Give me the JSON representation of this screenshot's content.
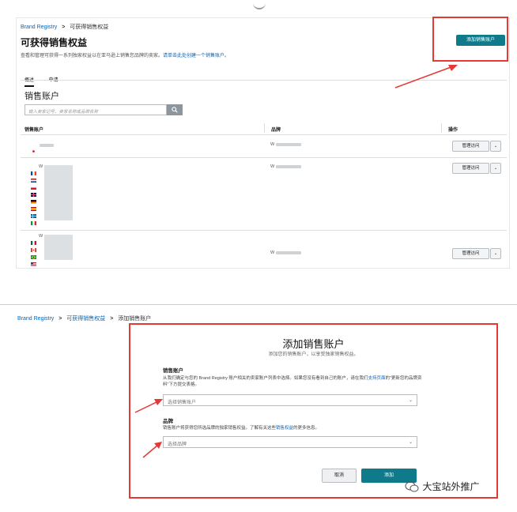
{
  "top": {
    "breadcrumb": {
      "root": "Brand Registry",
      "sep": ">",
      "current": "可获得销售权益"
    },
    "title": "可获得销售权益",
    "description": "查看和管理可获得一系列独家权益以在亚马逊上销售您品牌的卖家。",
    "description_link": "请单击此处创建一个销售账户。",
    "add_button": "添加销售账户",
    "tabs": [
      "概述",
      "申请"
    ],
    "section_title": "销售账户",
    "search_placeholder": "输入卖家记号、卖家名称或品牌名称",
    "search_icon": "search-icon",
    "columns": {
      "account": "销售账户",
      "brand": "品牌",
      "action": "操作"
    },
    "rows": [
      {
        "brand_prefix": "W",
        "manage": "管理访问",
        "flags": [
          "jp"
        ]
      },
      {
        "brand_prefix": "W",
        "manage": "管理访问",
        "flags": [
          "fr",
          "nl",
          "pl",
          "uk",
          "de",
          "es",
          "se",
          "it"
        ]
      },
      {
        "brand_prefix": "W",
        "manage": "管理访问",
        "flags": [
          "mx",
          "ca",
          "br",
          "us"
        ]
      }
    ],
    "account_prefix": "W"
  },
  "bottom": {
    "breadcrumb": {
      "root": "Brand Registry",
      "sep": ">",
      "mid": "可获得销售权益",
      "current": "添加销售账户"
    },
    "title": "添加销售账户",
    "subtitle": "添加您的销售账户，以享受独家销售权益。",
    "account_label": "销售账户",
    "account_help_1": "从我们确定与您的 Brand Registry 账户相关的卖家账户列表中选择。如果您没有看到自己的账户，请在我们",
    "account_help_link": "支持页面",
    "account_help_2": "的\"更新您的品牌资料\"下方提交表格。",
    "account_placeholder": "选择销售账户",
    "brand_label": "品牌",
    "brand_help_1": "销售账户将获得您所选品牌的独家销售权益。了解有关这些",
    "brand_help_link": "销售权益",
    "brand_help_2": "的更多信息。",
    "brand_placeholder": "选择品牌",
    "cancel": "取消",
    "add": "添加",
    "watermark": "大宝站外推广"
  },
  "colors": {
    "accent": "#0f7b8a",
    "highlight": "#e53935",
    "link": "#0066c0"
  }
}
